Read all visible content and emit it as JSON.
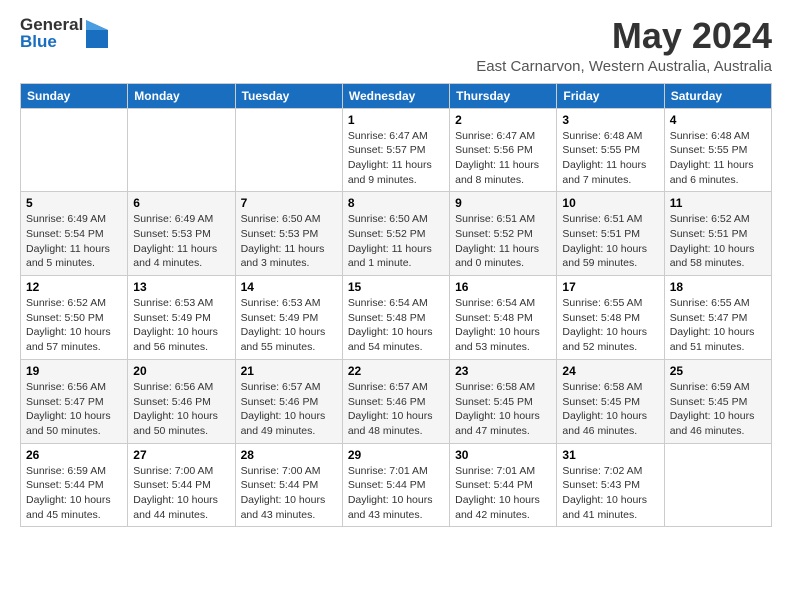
{
  "logo": {
    "general": "General",
    "blue": "Blue"
  },
  "title": "May 2024",
  "location": "East Carnarvon, Western Australia, Australia",
  "days_of_week": [
    "Sunday",
    "Monday",
    "Tuesday",
    "Wednesday",
    "Thursday",
    "Friday",
    "Saturday"
  ],
  "weeks": [
    [
      {
        "day": "",
        "info": ""
      },
      {
        "day": "",
        "info": ""
      },
      {
        "day": "",
        "info": ""
      },
      {
        "day": "1",
        "info": "Sunrise: 6:47 AM\nSunset: 5:57 PM\nDaylight: 11 hours\nand 9 minutes."
      },
      {
        "day": "2",
        "info": "Sunrise: 6:47 AM\nSunset: 5:56 PM\nDaylight: 11 hours\nand 8 minutes."
      },
      {
        "day": "3",
        "info": "Sunrise: 6:48 AM\nSunset: 5:55 PM\nDaylight: 11 hours\nand 7 minutes."
      },
      {
        "day": "4",
        "info": "Sunrise: 6:48 AM\nSunset: 5:55 PM\nDaylight: 11 hours\nand 6 minutes."
      }
    ],
    [
      {
        "day": "5",
        "info": "Sunrise: 6:49 AM\nSunset: 5:54 PM\nDaylight: 11 hours\nand 5 minutes."
      },
      {
        "day": "6",
        "info": "Sunrise: 6:49 AM\nSunset: 5:53 PM\nDaylight: 11 hours\nand 4 minutes."
      },
      {
        "day": "7",
        "info": "Sunrise: 6:50 AM\nSunset: 5:53 PM\nDaylight: 11 hours\nand 3 minutes."
      },
      {
        "day": "8",
        "info": "Sunrise: 6:50 AM\nSunset: 5:52 PM\nDaylight: 11 hours\nand 1 minute."
      },
      {
        "day": "9",
        "info": "Sunrise: 6:51 AM\nSunset: 5:52 PM\nDaylight: 11 hours\nand 0 minutes."
      },
      {
        "day": "10",
        "info": "Sunrise: 6:51 AM\nSunset: 5:51 PM\nDaylight: 10 hours\nand 59 minutes."
      },
      {
        "day": "11",
        "info": "Sunrise: 6:52 AM\nSunset: 5:51 PM\nDaylight: 10 hours\nand 58 minutes."
      }
    ],
    [
      {
        "day": "12",
        "info": "Sunrise: 6:52 AM\nSunset: 5:50 PM\nDaylight: 10 hours\nand 57 minutes."
      },
      {
        "day": "13",
        "info": "Sunrise: 6:53 AM\nSunset: 5:49 PM\nDaylight: 10 hours\nand 56 minutes."
      },
      {
        "day": "14",
        "info": "Sunrise: 6:53 AM\nSunset: 5:49 PM\nDaylight: 10 hours\nand 55 minutes."
      },
      {
        "day": "15",
        "info": "Sunrise: 6:54 AM\nSunset: 5:48 PM\nDaylight: 10 hours\nand 54 minutes."
      },
      {
        "day": "16",
        "info": "Sunrise: 6:54 AM\nSunset: 5:48 PM\nDaylight: 10 hours\nand 53 minutes."
      },
      {
        "day": "17",
        "info": "Sunrise: 6:55 AM\nSunset: 5:48 PM\nDaylight: 10 hours\nand 52 minutes."
      },
      {
        "day": "18",
        "info": "Sunrise: 6:55 AM\nSunset: 5:47 PM\nDaylight: 10 hours\nand 51 minutes."
      }
    ],
    [
      {
        "day": "19",
        "info": "Sunrise: 6:56 AM\nSunset: 5:47 PM\nDaylight: 10 hours\nand 50 minutes."
      },
      {
        "day": "20",
        "info": "Sunrise: 6:56 AM\nSunset: 5:46 PM\nDaylight: 10 hours\nand 50 minutes."
      },
      {
        "day": "21",
        "info": "Sunrise: 6:57 AM\nSunset: 5:46 PM\nDaylight: 10 hours\nand 49 minutes."
      },
      {
        "day": "22",
        "info": "Sunrise: 6:57 AM\nSunset: 5:46 PM\nDaylight: 10 hours\nand 48 minutes."
      },
      {
        "day": "23",
        "info": "Sunrise: 6:58 AM\nSunset: 5:45 PM\nDaylight: 10 hours\nand 47 minutes."
      },
      {
        "day": "24",
        "info": "Sunrise: 6:58 AM\nSunset: 5:45 PM\nDaylight: 10 hours\nand 46 minutes."
      },
      {
        "day": "25",
        "info": "Sunrise: 6:59 AM\nSunset: 5:45 PM\nDaylight: 10 hours\nand 46 minutes."
      }
    ],
    [
      {
        "day": "26",
        "info": "Sunrise: 6:59 AM\nSunset: 5:44 PM\nDaylight: 10 hours\nand 45 minutes."
      },
      {
        "day": "27",
        "info": "Sunrise: 7:00 AM\nSunset: 5:44 PM\nDaylight: 10 hours\nand 44 minutes."
      },
      {
        "day": "28",
        "info": "Sunrise: 7:00 AM\nSunset: 5:44 PM\nDaylight: 10 hours\nand 43 minutes."
      },
      {
        "day": "29",
        "info": "Sunrise: 7:01 AM\nSunset: 5:44 PM\nDaylight: 10 hours\nand 43 minutes."
      },
      {
        "day": "30",
        "info": "Sunrise: 7:01 AM\nSunset: 5:44 PM\nDaylight: 10 hours\nand 42 minutes."
      },
      {
        "day": "31",
        "info": "Sunrise: 7:02 AM\nSunset: 5:43 PM\nDaylight: 10 hours\nand 41 minutes."
      },
      {
        "day": "",
        "info": ""
      }
    ]
  ]
}
